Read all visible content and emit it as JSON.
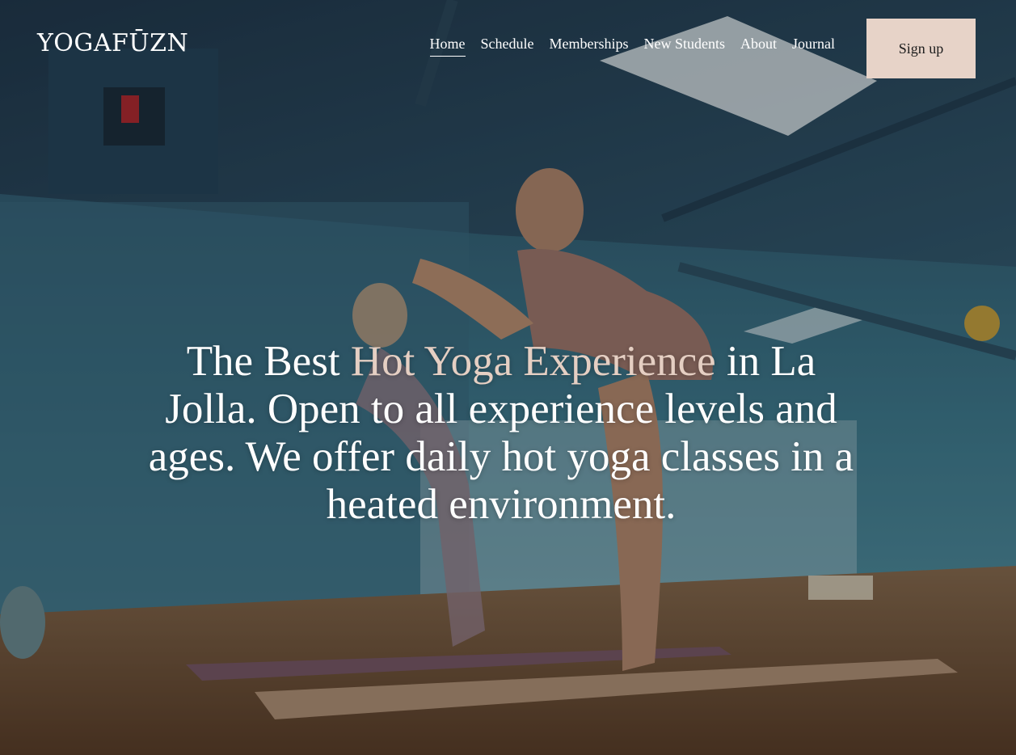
{
  "brand": {
    "logo_text": "YOGAFŪZN"
  },
  "nav": {
    "items": [
      {
        "label": "Home",
        "active": true
      },
      {
        "label": "Schedule",
        "active": false
      },
      {
        "label": "Memberships",
        "active": false
      },
      {
        "label": "New Students",
        "active": false
      },
      {
        "label": "About",
        "active": false
      },
      {
        "label": "Journal",
        "active": false
      }
    ],
    "signup_label": "Sign up"
  },
  "hero": {
    "headline_part1": "The Best ",
    "headline_accent": "Hot Yoga Experience",
    "headline_part2": " in La Jolla. Open to all experience levels and ages. We offer daily hot yoga classes in a heated environment."
  },
  "colors": {
    "accent": "#e5cfc3",
    "button_bg": "#e7d3c8",
    "button_text": "#1d1d1d",
    "text": "#ffffff"
  }
}
